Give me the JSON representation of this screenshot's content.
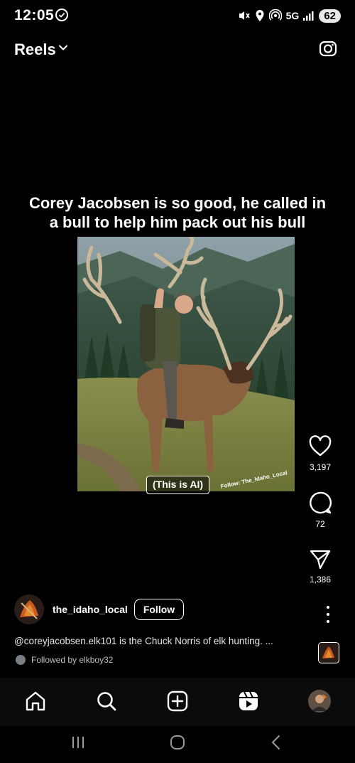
{
  "status_bar": {
    "time": "12:05",
    "network": "5G",
    "battery": "62"
  },
  "header": {
    "title": "Reels"
  },
  "post": {
    "headline_line1": "Corey Jacobsen is so good, he called in",
    "headline_line2": "a bull to help him pack out his bull",
    "ai_tag": "(This is AI)",
    "watermark": "Follow: The_Idaho_Local",
    "username": "the_idaho_local",
    "follow_label": "Follow",
    "caption_mention": "@coreyjacobsen.elk101",
    "caption_text": " is the Chuck Norris of elk hunting. ...",
    "followed_by_prefix": "Followed by ",
    "followed_by_user": "elkboy32"
  },
  "actions": {
    "likes": "3,197",
    "comments": "72",
    "shares": "1,386"
  },
  "nav": [
    "home-icon",
    "search-icon",
    "create-icon",
    "reels-icon",
    "profile-avatar"
  ]
}
